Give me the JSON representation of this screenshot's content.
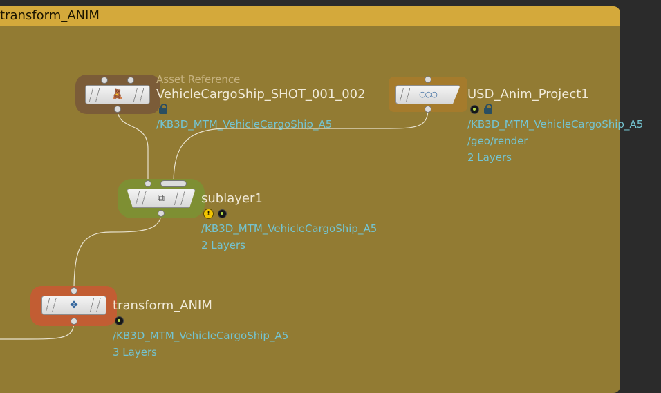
{
  "network": {
    "title": "transform_ANIM",
    "nodes": {
      "asset_ref": {
        "type_label": "Asset Reference",
        "name": "VehicleCargoShip_SHOT_001_002",
        "path": "/KB3D_MTM_VehicleCargoShip_A5",
        "icon": "teddy-bear-icon"
      },
      "usd_anim": {
        "name": "USD_Anim_Project1",
        "path": "/KB3D_MTM_VehicleCargoShip_A5",
        "sub_path": "/geo/render",
        "layers": "2 Layers",
        "icon": "usd-icon"
      },
      "sublayer": {
        "name": "sublayer1",
        "path": "/KB3D_MTM_VehicleCargoShip_A5",
        "layers": "2 Layers",
        "icon": "sublayer-icon"
      },
      "transform": {
        "name": "transform_ANIM",
        "path": "/KB3D_MTM_VehicleCargoShip_A5",
        "layers": "3 Layers",
        "icon": "transform-icon"
      }
    }
  },
  "colors": {
    "frame_background": "#927b33",
    "frame_header": "#d4a93b",
    "asset_ref_halo": "#7b5c38",
    "usd_anim_halo": "#a57b2c",
    "sublayer_halo": "#7e8f33",
    "transform_halo": "#c25d33",
    "path_text": "#74c4d1"
  }
}
